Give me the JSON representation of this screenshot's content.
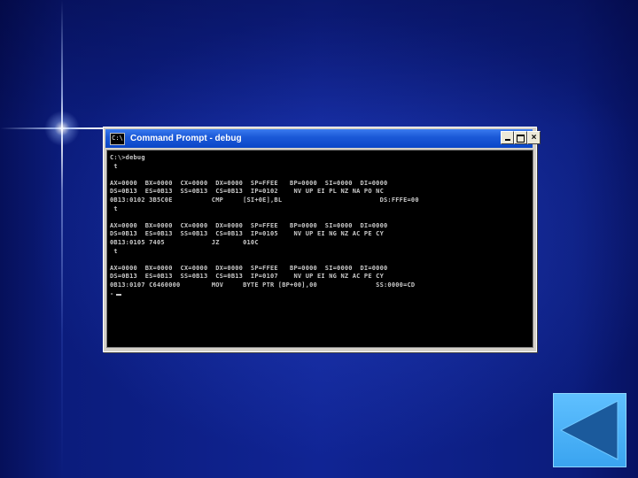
{
  "window": {
    "title": "Command Prompt - debug",
    "icon": "cmd-icon",
    "icon_glyph": "C:\\",
    "buttons": [
      "minimize",
      "maximize",
      "close"
    ],
    "close_glyph": "×"
  },
  "console": {
    "lines": [
      "C:\\>debug",
      " t",
      "",
      "AX=0000  BX=0000  CX=0000  DX=0000  SP=FFEE   BP=0000  SI=0000  DI=0000",
      "DS=0B13  ES=0B13  SS=0B13  CS=0B13  IP=0102    NV UP EI PL NZ NA PO NC",
      "0B13:0102 3B5C0E          CMP     [SI+0E],BL                         DS:FFFE=00",
      " t",
      "",
      "AX=0000  BX=0000  CX=0000  DX=0000  SP=FFEE   BP=0000  SI=0000  DI=0000",
      "DS=0B13  ES=0B13  SS=0B13  CS=0B13  IP=0105    NV UP EI NG NZ AC PE CY",
      "0B13:0105 7405            JZ      010C",
      " t",
      "",
      "AX=0000  BX=0000  CX=0000  DX=0000  SP=FFEE   BP=0000  SI=0000  DI=0000",
      "DS=0B13  ES=0B13  SS=0B13  CS=0B13  IP=0107    NV UP EI NG NZ AC PE CY",
      "0B13:0107 C6460000        MOV     BYTE PTR [BP+00],00               SS:0000=CD",
      "-"
    ]
  },
  "nav": {
    "back_icon": "back-triangle-icon"
  },
  "colors": {
    "background": "#0b1c7c",
    "titlebar": "#1c5ad8",
    "console_bg": "#000000",
    "console_text": "#c8c8c8",
    "nav_button": "#4fb2f6",
    "nav_arrow": "#1b5a9c"
  }
}
